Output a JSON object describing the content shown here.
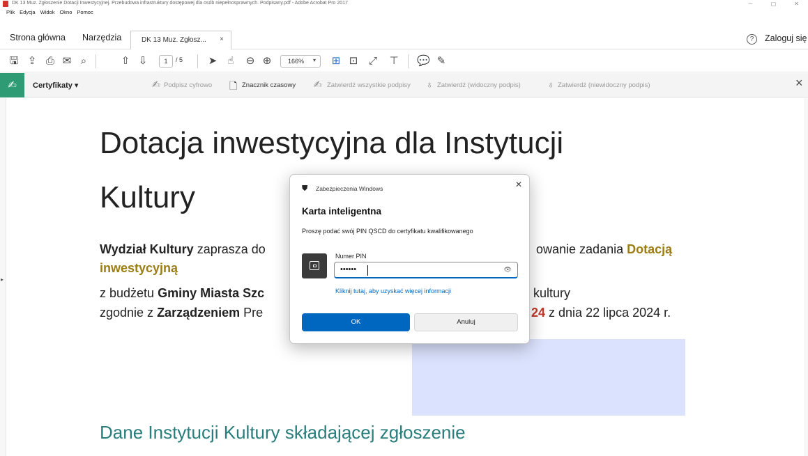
{
  "window": {
    "title": "DK 13 Muz. Zgłoszenie Dotacji Inwestycyjnej. Przebudowa infrastruktury dostępowej dla osób niepełnosprawnych. Podpisany.pdf - Adobe Acrobat Pro 2017",
    "minimize": "─",
    "maximize": "▢",
    "close": "✕"
  },
  "menu": [
    "Plik",
    "Edycja",
    "Widok",
    "Okno",
    "Pomoc"
  ],
  "tabs": {
    "home": "Strona główna",
    "tools": "Narzędzia",
    "document": "DK 13 Muz. Zgłosz...",
    "document_close": "×"
  },
  "account": {
    "help": "?",
    "login": "Zaloguj się"
  },
  "toolbar": {
    "page_current": "1",
    "page_total": "/ 5",
    "zoom": "166%"
  },
  "certificates": {
    "label": "Certyfikaty",
    "caret": "▾",
    "items": [
      "Podpisz cyfrowo",
      "Znacznik czasowy",
      "Zatwierdź wszystkie podpisy",
      "Zatwierdź (widoczny podpis)",
      "Zatwierdź (niewidoczny podpis)"
    ],
    "close": "×"
  },
  "document": {
    "heading_line1": "Dotacja inwestycyjna dla Instytucji",
    "heading_line2": "Kultury",
    "p1_bold": "Wydział Kultury",
    "p1_text": " zaprasza do",
    "p1_right": "owanie zadania ",
    "p1_highlight": "Dotacją",
    "p2_highlight": "inwestycyjną",
    "p3_prefix": "z budżetu ",
    "p3_bold": "Gminy Miasta Szc",
    "p3_right": "kultury",
    "p4_prefix": "zgodnie z ",
    "p4_bold": "Zarządzeniem",
    "p4_text": " Pre",
    "p4_red": "24",
    "p4_right": " z dnia 22 lipca 2024 r.",
    "section_heading": "Dane Instytucji Kultury składającej zgłoszenie"
  },
  "dialog": {
    "header": "Zabezpieczenia Windows",
    "close": "✕",
    "title": "Karta inteligentna",
    "description": "Proszę podać swój PIN QSCD do certyfikatu kwalifikowanego",
    "pin_label": "Numer PIN",
    "pin_value": "••••••",
    "link": "Kliknij tutaj, aby uzyskać więcej informacji",
    "ok": "OK",
    "cancel": "Anuluj"
  }
}
